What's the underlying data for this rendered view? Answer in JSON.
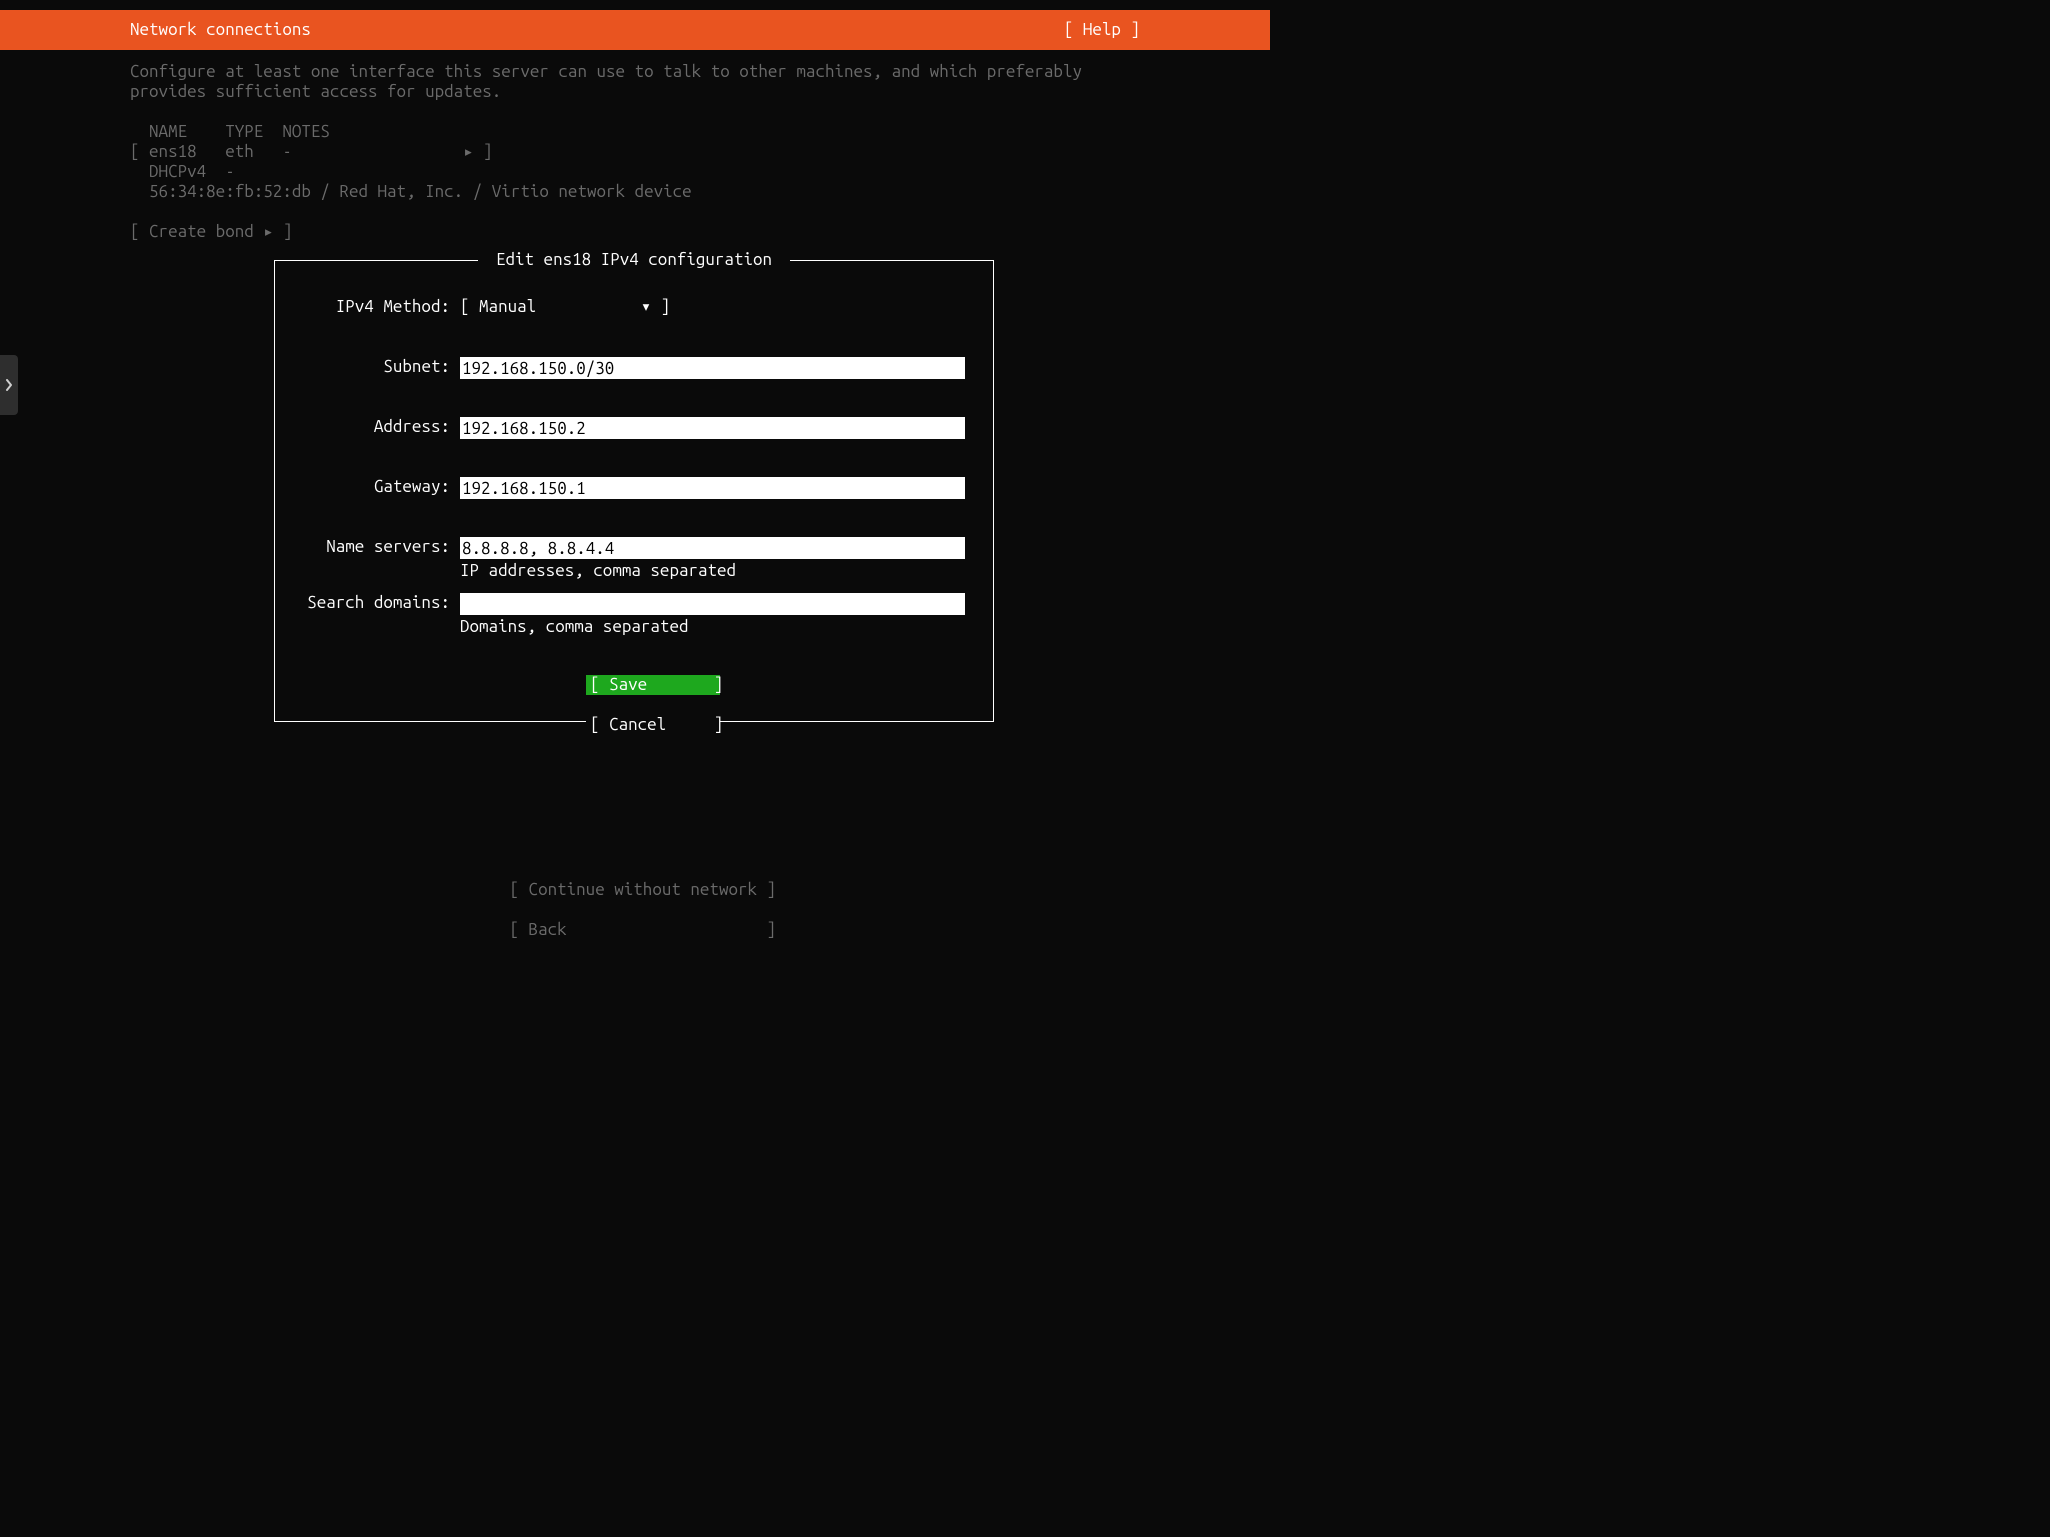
{
  "header": {
    "title": "Network connections",
    "help_label": "[ Help ]"
  },
  "intro_line1": "Configure at least one interface this server can use to talk to other machines, and which preferably",
  "intro_line2": "provides sufficient access for updates.",
  "iface_table": {
    "headers": "  NAME    TYPE  NOTES",
    "row": "[ ens18   eth   -                  ▸ ]",
    "dhcp": "  DHCPv4  -",
    "mac": "  56:34:8e:fb:52:db / Red Hat, Inc. / Virtio network device"
  },
  "create_bond": "[ Create bond ▸ ]",
  "dialog": {
    "title": " Edit ens18 IPv4 configuration ",
    "method_label": "IPv4 Method:",
    "method_value": "[ Manual           ▾ ]",
    "subnet_label": "Subnet:",
    "subnet_value": "192.168.150.0/30",
    "address_label": "Address:",
    "address_value": "192.168.150.2",
    "gateway_label": "Gateway:",
    "gateway_value": "192.168.150.1",
    "dns_label": "Name servers:",
    "dns_value": "8.8.8.8, 8.8.4.4",
    "dns_hint": "IP addresses, comma separated",
    "search_label": "Search domains:",
    "search_value": "",
    "search_hint": "Domains, comma separated",
    "save_label": "[ Save       ]",
    "cancel_label": "[ Cancel     ]"
  },
  "footer": {
    "continue_label": "[ Continue without network ]",
    "back_label": "[ Back                     ]"
  }
}
